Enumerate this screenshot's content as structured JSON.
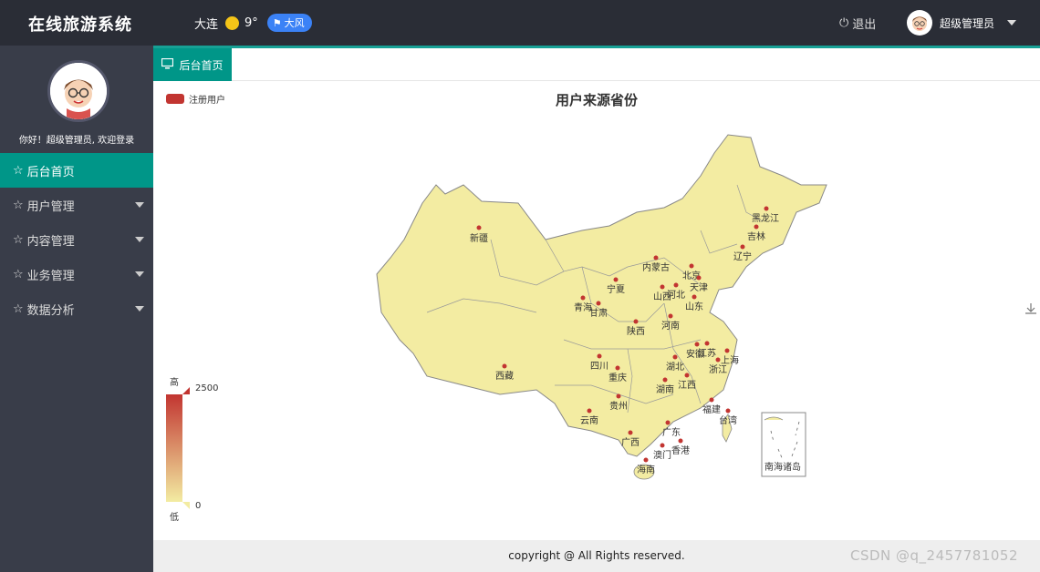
{
  "app": {
    "title": "在线旅游系统"
  },
  "weather": {
    "city": "大连",
    "temp": "9°",
    "wind": "大风"
  },
  "header": {
    "logout_label": "退出",
    "user_name": "超级管理员"
  },
  "sidebar": {
    "welcome": "你好！超级管理员, 欢迎登录",
    "items": [
      {
        "label": "后台首页",
        "active": true
      },
      {
        "label": "用户管理"
      },
      {
        "label": "内容管理"
      },
      {
        "label": "业务管理"
      },
      {
        "label": "数据分析"
      }
    ]
  },
  "tabs": [
    {
      "label": "后台首页"
    }
  ],
  "chart_data": {
    "type": "map",
    "title": "用户来源省份",
    "legend": [
      "注册用户"
    ],
    "visual_map": {
      "min": 0,
      "max": 2500,
      "high_label": "高",
      "low_label": "低",
      "max_text": "2500",
      "min_text": "0"
    },
    "regions": [
      "新疆",
      "西藏",
      "青海",
      "甘肃",
      "宁夏",
      "内蒙古",
      "黑龙江",
      "吉林",
      "辽宁",
      "北京",
      "天津",
      "河北",
      "山西",
      "山东",
      "河南",
      "陕西",
      "四川",
      "重庆",
      "湖北",
      "安徽",
      "江苏",
      "上海",
      "浙江",
      "湖南",
      "江西",
      "贵州",
      "云南",
      "广西",
      "广东",
      "福建",
      "台湾",
      "澳门",
      "香港",
      "海南",
      "南海诸岛"
    ]
  },
  "footer": {
    "copyright": "copyright @ All Rights reserved."
  },
  "watermark": "CSDN @q_2457781052",
  "colors": {
    "accent": "#009688",
    "topbar": "#2a2d36",
    "sidebar": "#393d49",
    "map_fill": "#f3eca2",
    "point": "#c23531"
  }
}
